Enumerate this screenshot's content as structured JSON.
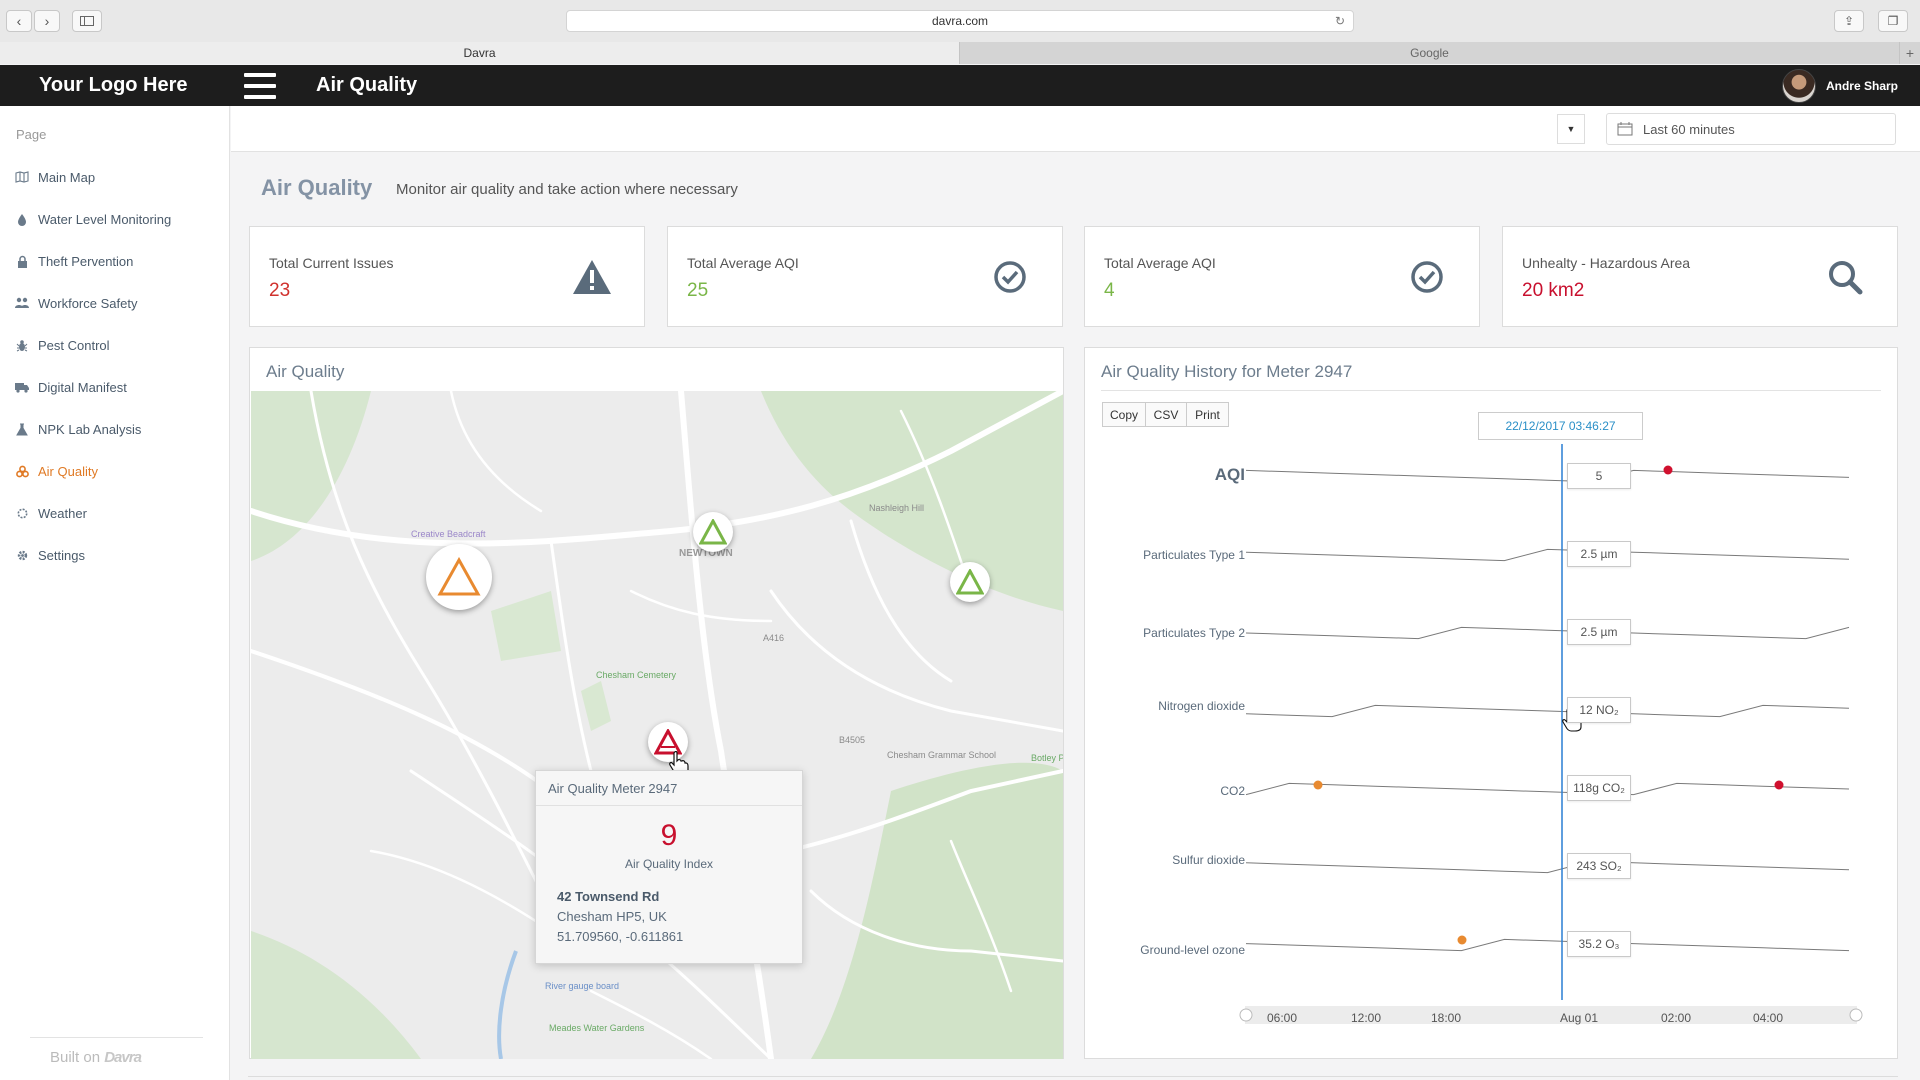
{
  "browser": {
    "url": "davra.com",
    "tabs": [
      {
        "label": "Davra",
        "active": true
      },
      {
        "label": "Google",
        "active": false
      }
    ],
    "new_tab": "+"
  },
  "header": {
    "logo": "Your Logo Here",
    "title": "Air Quality",
    "user_name": "Andre Sharp"
  },
  "sidebar": {
    "heading": "Page",
    "items": [
      {
        "label": "Main Map",
        "icon": "map-icon"
      },
      {
        "label": "Water Level Monitoring",
        "icon": "drop-icon"
      },
      {
        "label": "Theft Pervention",
        "icon": "lock-icon"
      },
      {
        "label": "Workforce Safety",
        "icon": "users-icon"
      },
      {
        "label": "Pest Control",
        "icon": "bug-icon"
      },
      {
        "label": "Digital Manifest",
        "icon": "truck-icon"
      },
      {
        "label": "NPK Lab Analysis",
        "icon": "flask-icon"
      },
      {
        "label": "Air Quality",
        "icon": "biohazard-icon",
        "active": true
      },
      {
        "label": "Weather",
        "icon": "sun-icon"
      },
      {
        "label": "Settings",
        "icon": "gear-icon"
      }
    ],
    "built_on": "Built on",
    "built_brand": "Davra"
  },
  "filter": {
    "date_range": "Last 60 minutes"
  },
  "page": {
    "title": "Air Quality",
    "subtitle": "Monitor air quality and take action where necessary"
  },
  "stats": [
    {
      "label": "Total Current Issues",
      "value": "23",
      "color": "#d0312d",
      "icon": "warning-icon"
    },
    {
      "label": "Total Average AQI",
      "value": "25",
      "color": "#7ab648",
      "icon": "check-circle-icon"
    },
    {
      "label": "Total Average AQI",
      "value": "4",
      "color": "#7ab648",
      "icon": "check-circle-icon"
    },
    {
      "label": "Unhealty - Hazardous Area",
      "value": "20 km2",
      "color": "#c8102e",
      "icon": "search-icon"
    }
  ],
  "map_panel": {
    "title": "Air Quality",
    "labels": {
      "poi1": "Creative Beadcraft",
      "poi2": "Chesham Cemetery",
      "poi3": "Chesham Grammar School",
      "poi4": "Botley Playing Field",
      "poi5": "River gauge board",
      "poi6": "Meades Water Gardens",
      "road1": "A416",
      "road2": "B4505",
      "road3": "Nashleigh Hill",
      "area": "NEWTOWN"
    },
    "popup": {
      "title": "Air Quality Meter 2947",
      "value": "9",
      "value_label": "Air Quality Index",
      "address": "42 Townsend Rd",
      "city": "Chesham HP5, UK",
      "coords": "51.709560, -0.611861"
    }
  },
  "history_panel": {
    "title": "Air Quality History for Meter 2947",
    "buttons": [
      "Copy",
      "CSV",
      "Print"
    ],
    "cursor_time": "22/12/2017 03:46:27",
    "x_ticks": [
      "06:00",
      "12:00",
      "18:00",
      "Aug 01",
      "02:00",
      "04:00"
    ]
  },
  "chart_data": {
    "type": "line",
    "x": [
      "06:00",
      "12:00",
      "18:00",
      "Aug 01",
      "02:00",
      "04:00"
    ],
    "series": [
      {
        "name": "AQI",
        "current": "5"
      },
      {
        "name": "Particulates Type 1",
        "current": "2.5 µm"
      },
      {
        "name": "Particulates Type 2",
        "current": "2.5 µm"
      },
      {
        "name": "Nitrogen dioxide",
        "current": "12 NO₂"
      },
      {
        "name": "CO2",
        "current": "118g CO₂"
      },
      {
        "name": "Sulfur dioxide",
        "current": "243 SO₂"
      },
      {
        "name": "Ground-level ozone",
        "current": "35.2 O₃"
      }
    ],
    "colors": {
      "line": "#7a7a7a",
      "cursor": "#2a7fd4",
      "alert": "#d0102e",
      "warn": "#e88a30"
    }
  }
}
